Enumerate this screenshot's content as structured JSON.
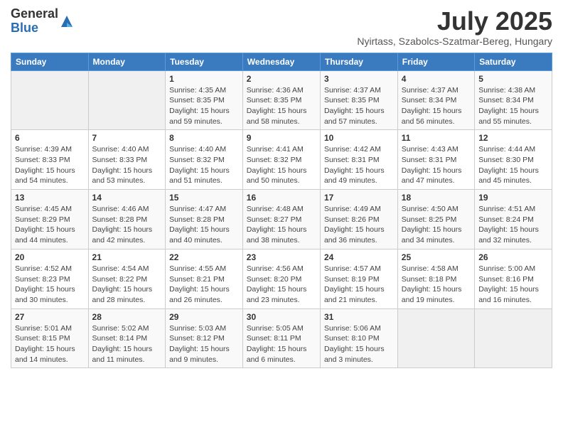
{
  "header": {
    "logo_general": "General",
    "logo_blue": "Blue",
    "month_title": "July 2025",
    "location": "Nyirtass, Szabolcs-Szatmar-Bereg, Hungary"
  },
  "weekdays": [
    "Sunday",
    "Monday",
    "Tuesday",
    "Wednesday",
    "Thursday",
    "Friday",
    "Saturday"
  ],
  "weeks": [
    [
      {
        "day": "",
        "sunrise": "",
        "sunset": "",
        "daylight": ""
      },
      {
        "day": "",
        "sunrise": "",
        "sunset": "",
        "daylight": ""
      },
      {
        "day": "1",
        "sunrise": "Sunrise: 4:35 AM",
        "sunset": "Sunset: 8:35 PM",
        "daylight": "Daylight: 15 hours and 59 minutes."
      },
      {
        "day": "2",
        "sunrise": "Sunrise: 4:36 AM",
        "sunset": "Sunset: 8:35 PM",
        "daylight": "Daylight: 15 hours and 58 minutes."
      },
      {
        "day": "3",
        "sunrise": "Sunrise: 4:37 AM",
        "sunset": "Sunset: 8:35 PM",
        "daylight": "Daylight: 15 hours and 57 minutes."
      },
      {
        "day": "4",
        "sunrise": "Sunrise: 4:37 AM",
        "sunset": "Sunset: 8:34 PM",
        "daylight": "Daylight: 15 hours and 56 minutes."
      },
      {
        "day": "5",
        "sunrise": "Sunrise: 4:38 AM",
        "sunset": "Sunset: 8:34 PM",
        "daylight": "Daylight: 15 hours and 55 minutes."
      }
    ],
    [
      {
        "day": "6",
        "sunrise": "Sunrise: 4:39 AM",
        "sunset": "Sunset: 8:33 PM",
        "daylight": "Daylight: 15 hours and 54 minutes."
      },
      {
        "day": "7",
        "sunrise": "Sunrise: 4:40 AM",
        "sunset": "Sunset: 8:33 PM",
        "daylight": "Daylight: 15 hours and 53 minutes."
      },
      {
        "day": "8",
        "sunrise": "Sunrise: 4:40 AM",
        "sunset": "Sunset: 8:32 PM",
        "daylight": "Daylight: 15 hours and 51 minutes."
      },
      {
        "day": "9",
        "sunrise": "Sunrise: 4:41 AM",
        "sunset": "Sunset: 8:32 PM",
        "daylight": "Daylight: 15 hours and 50 minutes."
      },
      {
        "day": "10",
        "sunrise": "Sunrise: 4:42 AM",
        "sunset": "Sunset: 8:31 PM",
        "daylight": "Daylight: 15 hours and 49 minutes."
      },
      {
        "day": "11",
        "sunrise": "Sunrise: 4:43 AM",
        "sunset": "Sunset: 8:31 PM",
        "daylight": "Daylight: 15 hours and 47 minutes."
      },
      {
        "day": "12",
        "sunrise": "Sunrise: 4:44 AM",
        "sunset": "Sunset: 8:30 PM",
        "daylight": "Daylight: 15 hours and 45 minutes."
      }
    ],
    [
      {
        "day": "13",
        "sunrise": "Sunrise: 4:45 AM",
        "sunset": "Sunset: 8:29 PM",
        "daylight": "Daylight: 15 hours and 44 minutes."
      },
      {
        "day": "14",
        "sunrise": "Sunrise: 4:46 AM",
        "sunset": "Sunset: 8:28 PM",
        "daylight": "Daylight: 15 hours and 42 minutes."
      },
      {
        "day": "15",
        "sunrise": "Sunrise: 4:47 AM",
        "sunset": "Sunset: 8:28 PM",
        "daylight": "Daylight: 15 hours and 40 minutes."
      },
      {
        "day": "16",
        "sunrise": "Sunrise: 4:48 AM",
        "sunset": "Sunset: 8:27 PM",
        "daylight": "Daylight: 15 hours and 38 minutes."
      },
      {
        "day": "17",
        "sunrise": "Sunrise: 4:49 AM",
        "sunset": "Sunset: 8:26 PM",
        "daylight": "Daylight: 15 hours and 36 minutes."
      },
      {
        "day": "18",
        "sunrise": "Sunrise: 4:50 AM",
        "sunset": "Sunset: 8:25 PM",
        "daylight": "Daylight: 15 hours and 34 minutes."
      },
      {
        "day": "19",
        "sunrise": "Sunrise: 4:51 AM",
        "sunset": "Sunset: 8:24 PM",
        "daylight": "Daylight: 15 hours and 32 minutes."
      }
    ],
    [
      {
        "day": "20",
        "sunrise": "Sunrise: 4:52 AM",
        "sunset": "Sunset: 8:23 PM",
        "daylight": "Daylight: 15 hours and 30 minutes."
      },
      {
        "day": "21",
        "sunrise": "Sunrise: 4:54 AM",
        "sunset": "Sunset: 8:22 PM",
        "daylight": "Daylight: 15 hours and 28 minutes."
      },
      {
        "day": "22",
        "sunrise": "Sunrise: 4:55 AM",
        "sunset": "Sunset: 8:21 PM",
        "daylight": "Daylight: 15 hours and 26 minutes."
      },
      {
        "day": "23",
        "sunrise": "Sunrise: 4:56 AM",
        "sunset": "Sunset: 8:20 PM",
        "daylight": "Daylight: 15 hours and 23 minutes."
      },
      {
        "day": "24",
        "sunrise": "Sunrise: 4:57 AM",
        "sunset": "Sunset: 8:19 PM",
        "daylight": "Daylight: 15 hours and 21 minutes."
      },
      {
        "day": "25",
        "sunrise": "Sunrise: 4:58 AM",
        "sunset": "Sunset: 8:18 PM",
        "daylight": "Daylight: 15 hours and 19 minutes."
      },
      {
        "day": "26",
        "sunrise": "Sunrise: 5:00 AM",
        "sunset": "Sunset: 8:16 PM",
        "daylight": "Daylight: 15 hours and 16 minutes."
      }
    ],
    [
      {
        "day": "27",
        "sunrise": "Sunrise: 5:01 AM",
        "sunset": "Sunset: 8:15 PM",
        "daylight": "Daylight: 15 hours and 14 minutes."
      },
      {
        "day": "28",
        "sunrise": "Sunrise: 5:02 AM",
        "sunset": "Sunset: 8:14 PM",
        "daylight": "Daylight: 15 hours and 11 minutes."
      },
      {
        "day": "29",
        "sunrise": "Sunrise: 5:03 AM",
        "sunset": "Sunset: 8:12 PM",
        "daylight": "Daylight: 15 hours and 9 minutes."
      },
      {
        "day": "30",
        "sunrise": "Sunrise: 5:05 AM",
        "sunset": "Sunset: 8:11 PM",
        "daylight": "Daylight: 15 hours and 6 minutes."
      },
      {
        "day": "31",
        "sunrise": "Sunrise: 5:06 AM",
        "sunset": "Sunset: 8:10 PM",
        "daylight": "Daylight: 15 hours and 3 minutes."
      },
      {
        "day": "",
        "sunrise": "",
        "sunset": "",
        "daylight": ""
      },
      {
        "day": "",
        "sunrise": "",
        "sunset": "",
        "daylight": ""
      }
    ]
  ]
}
